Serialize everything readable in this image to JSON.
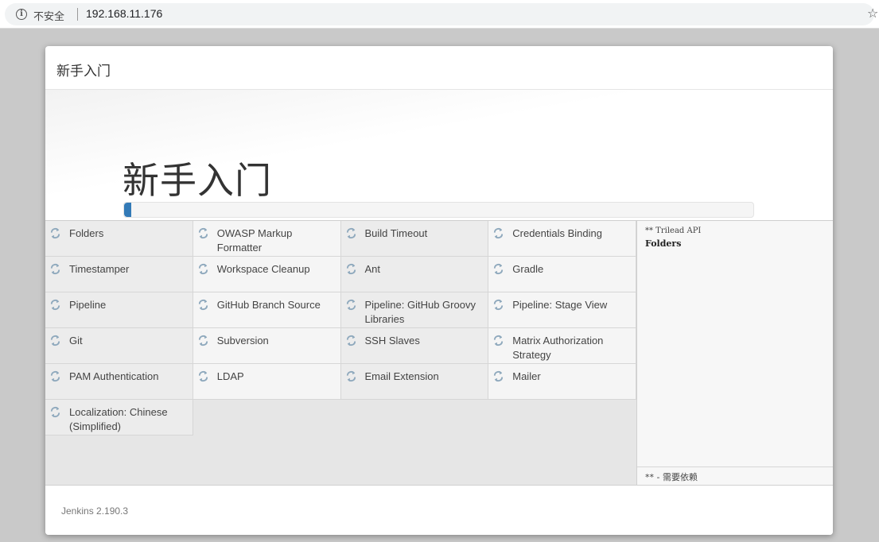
{
  "browser": {
    "security_label": "不安全",
    "url": "192.168.11.176",
    "info_icon_glyph": "i",
    "star_icon_glyph": "☆"
  },
  "dialog": {
    "title": "新手入门",
    "hero_title": "新手入门",
    "progress_fraction": 0.012
  },
  "plugins": [
    [
      "Folders",
      "OWASP Markup Formatter",
      "Build Timeout",
      "Credentials Binding"
    ],
    [
      "Timestamper",
      "Workspace Cleanup",
      "Ant",
      "Gradle"
    ],
    [
      "Pipeline",
      "GitHub Branch Source",
      "Pipeline: GitHub Groovy Libraries",
      "Pipeline: Stage View"
    ],
    [
      "Git",
      "Subversion",
      "SSH Slaves",
      "Matrix Authorization Strategy"
    ],
    [
      "PAM Authentication",
      "LDAP",
      "Email Extension",
      "Mailer"
    ],
    [
      "Localization: Chinese (Simplified)"
    ]
  ],
  "install_log": {
    "line1": "** Trilead API",
    "line2": "Folders",
    "legend": "** - 需要依赖"
  },
  "footer": {
    "version": "Jenkins 2.190.3"
  },
  "icons": {
    "plugin_status": "refresh-icon",
    "info": "info-icon",
    "bookmark": "star-icon"
  },
  "colors": {
    "progress": "#337ab7",
    "icon": "#8fa9bd"
  }
}
